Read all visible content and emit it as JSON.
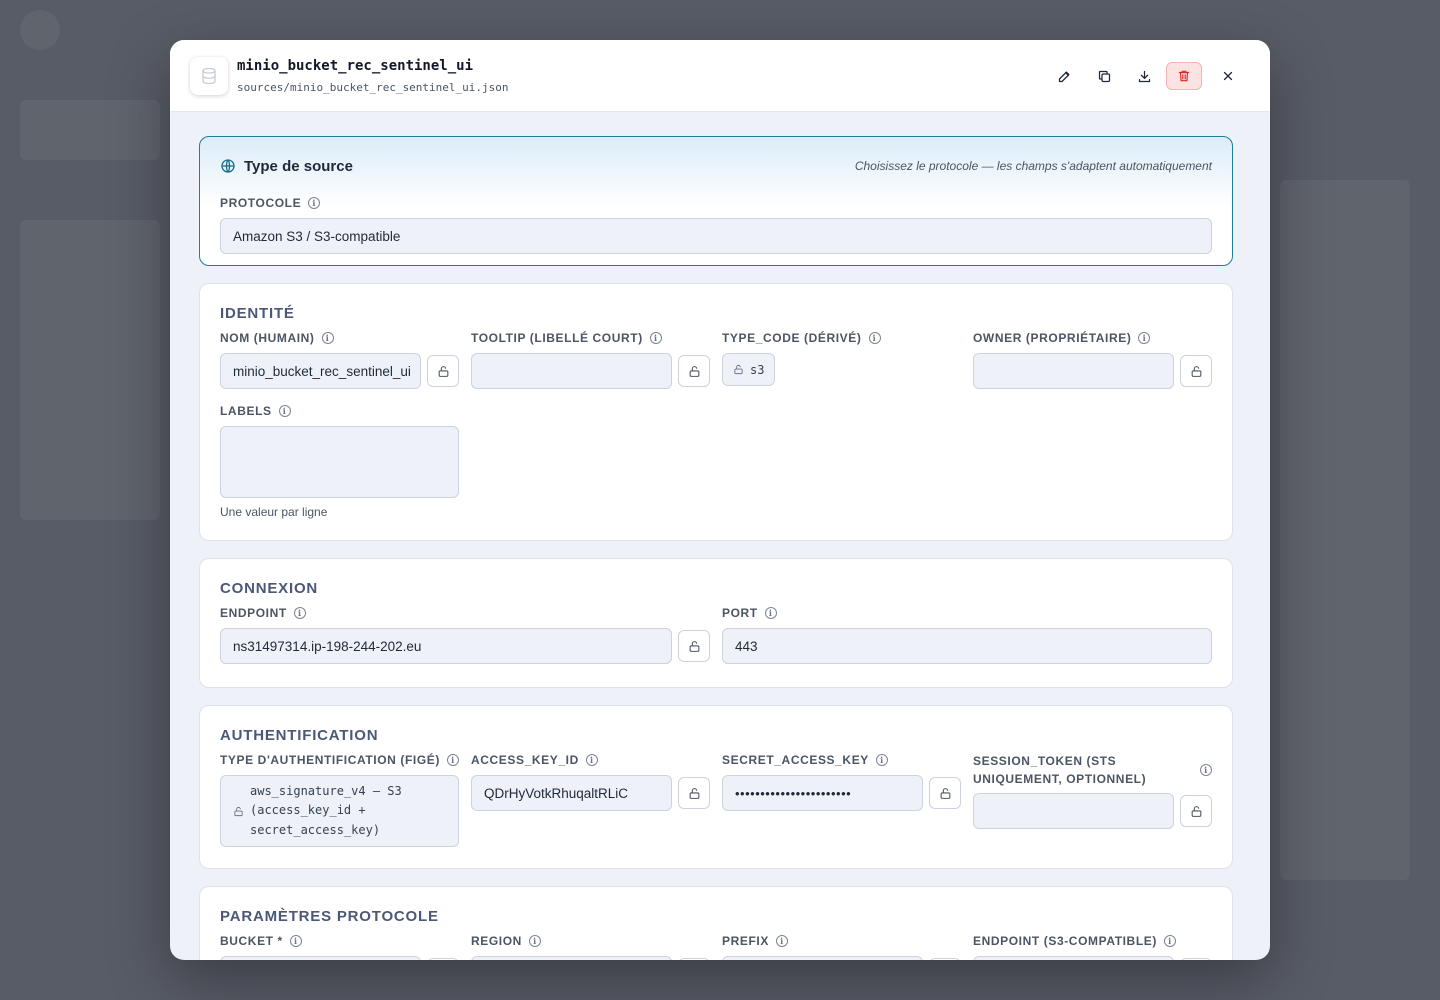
{
  "modal": {
    "title": "minio_bucket_rec_sentinel_ui",
    "path": "sources/minio_bucket_rec_sentinel_ui.json"
  },
  "source_type": {
    "title": "Type de source",
    "hint": "Choisissez le protocole — les champs s'adaptent automatiquement",
    "protocol_label": "PROTOCOLE",
    "protocol_value": "Amazon S3 / S3-compatible"
  },
  "identity": {
    "title": "IDENTITÉ",
    "name_label": "NOM (HUMAIN)",
    "name_value": "minio_bucket_rec_sentinel_ui",
    "tooltip_label": "TOOLTIP (LIBELLÉ COURT)",
    "tooltip_value": "",
    "type_code_label": "TYPE_CODE (DÉRIVÉ)",
    "type_code_value": "s3",
    "owner_label": "OWNER (PROPRIÉTAIRE)",
    "owner_value": "",
    "labels_label": "LABELS",
    "labels_help": "Une valeur par ligne"
  },
  "connection": {
    "title": "CONNEXION",
    "endpoint_label": "ENDPOINT",
    "endpoint_value": "ns31497314.ip-198-244-202.eu",
    "port_label": "PORT",
    "port_value": "443"
  },
  "auth": {
    "title": "AUTHENTIFICATION",
    "type_label": "TYPE D'AUTHENTIFICATION (FIGÉ)",
    "type_line1": "aws_signature_v4 — S3",
    "type_line2": "(access_key_id +",
    "type_line3": "secret_access_key)",
    "access_key_label": "ACCESS_KEY_ID",
    "access_key_value": "QDrHyVotkRhuqaltRLiC",
    "secret_label": "SECRET_ACCESS_KEY",
    "secret_value": "•••••••••••••••••••••••",
    "session_label_line1": "SESSION_TOKEN (STS",
    "session_label_line2": "UNIQUEMENT, OPTIONNEL)",
    "session_value": ""
  },
  "protocol_params": {
    "title": "PARAMÈTRES PROTOCOLE",
    "bucket_label": "BUCKET *",
    "region_label": "REGION",
    "prefix_label": "PREFIX",
    "endpoint_label": "ENDPOINT (S3-COMPATIBLE)"
  },
  "icons": {
    "header": "database-icon",
    "actions": [
      "edit-icon",
      "copy-icon",
      "download-icon",
      "trash-icon",
      "close-icon"
    ],
    "source": "globe-icon",
    "field_lock": "unlock-icon",
    "info": "info-icon"
  },
  "colors": {
    "accent": "#1d7f99",
    "danger_bg": "#fde2e2",
    "danger_icon": "#dc2626",
    "panel_bg": "#eef1f8"
  }
}
